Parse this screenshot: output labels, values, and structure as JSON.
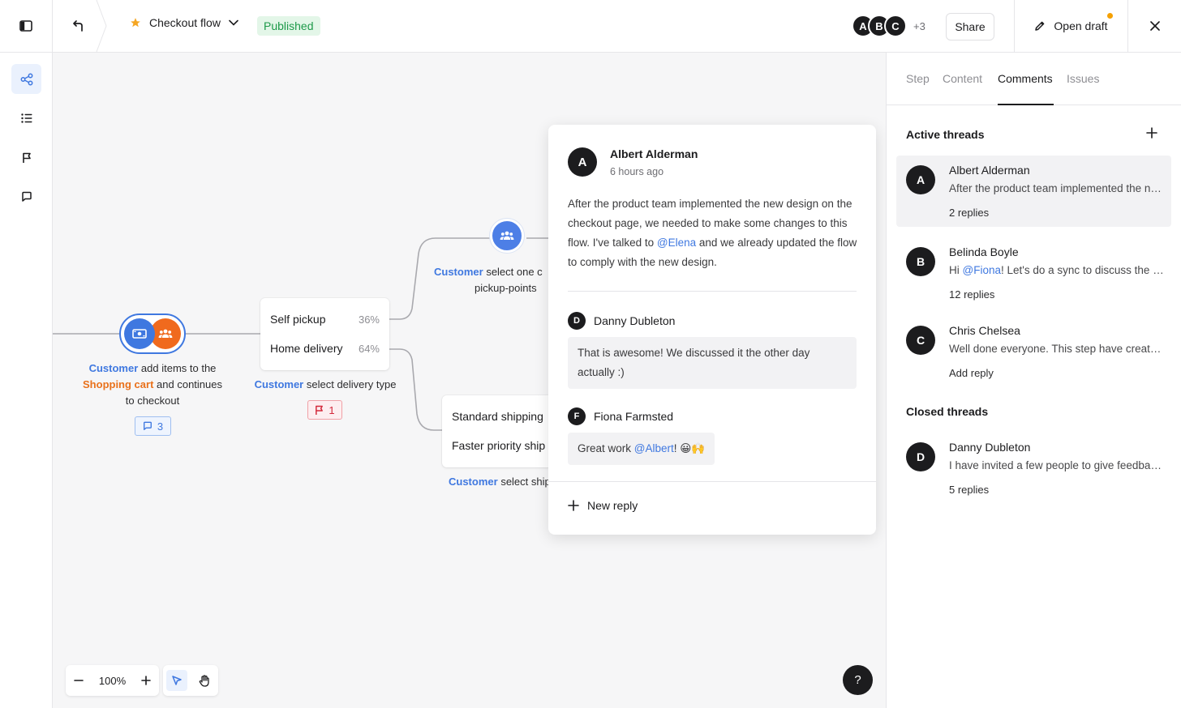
{
  "topbar": {
    "flow_title": "Checkout flow",
    "status": "Published",
    "avatars": [
      "A",
      "B",
      "C"
    ],
    "avatars_more": "+3",
    "share_label": "Share",
    "open_draft_label": "Open draft"
  },
  "canvas": {
    "node1": {
      "actor": "Customer",
      "text_a": "add items to the",
      "highlight": "Shopping cart",
      "text_b": "and continues",
      "text_c": "to checkout",
      "comments_count": "3"
    },
    "node2": {
      "options": [
        {
          "label": "Self pickup",
          "percent": "36%"
        },
        {
          "label": "Home delivery",
          "percent": "64%"
        }
      ],
      "actor": "Customer",
      "text": "select delivery type",
      "issues_count": "1"
    },
    "node3": {
      "actor": "Customer",
      "text_a": "select one c",
      "text_b": "pickup-points"
    },
    "node4": {
      "options": [
        {
          "label": "Standard shipping"
        },
        {
          "label": "Faster priority ship"
        }
      ],
      "actor": "Customer",
      "text": "select ship"
    },
    "zoom": "100%"
  },
  "popover": {
    "author_initial": "A",
    "author": "Albert Alderman",
    "time": "6 hours ago",
    "body_a": "After the product team implemented the new design on the checkout page, we needed to make some changes to this flow. I've talked to",
    "mention_1": "@Elena",
    "body_b": "and we already updated the flow to comply with the new design.",
    "replies": [
      {
        "initial": "D",
        "name": "Danny Dubleton",
        "text": "That is awesome! We discussed it the other day actually :)"
      },
      {
        "initial": "F",
        "name": "Fiona Farmsted",
        "text_a": "Great work",
        "mention": "@Albert",
        "text_b": "! 😀🙌"
      }
    ],
    "new_reply_label": "New reply"
  },
  "panel": {
    "tabs": [
      "Step",
      "Content",
      "Comments",
      "Issues"
    ],
    "active_tab": "Comments",
    "active_title": "Active threads",
    "closed_title": "Closed threads",
    "threads": [
      {
        "initial": "A",
        "name": "Albert Alderman",
        "preview": "After the product team implemented the new design on the checkout page",
        "replies": "2 replies"
      },
      {
        "initial": "B",
        "name": "Belinda Boyle",
        "preview_a": "Hi",
        "mention": "@Fiona",
        "preview_b": "! Let's do a sync to discuss the next steps",
        "replies": "12 replies"
      },
      {
        "initial": "C",
        "name": "Chris Chelsea",
        "preview": "Well done everyone. This step have created a lot of",
        "replies": "Add reply"
      }
    ],
    "closed_threads": [
      {
        "initial": "D",
        "name": "Danny Dubleton",
        "preview": "I have invited a few people to give feedback on this",
        "replies": "5 replies"
      }
    ]
  },
  "help_label": "?",
  "colors": {
    "accent": "#3f78e0",
    "orange": "#f06a1e",
    "published_bg": "#e3f6e8",
    "published_fg": "#1e9a4a"
  }
}
